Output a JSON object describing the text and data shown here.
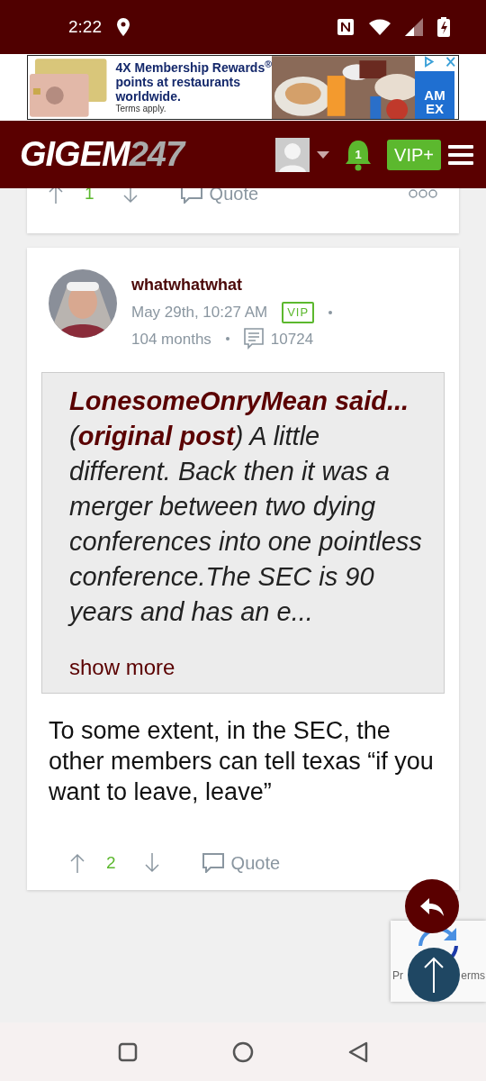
{
  "status_bar": {
    "time": "2:22"
  },
  "ad": {
    "lines": [
      "4X Membership Rewards$^{®}$",
      "points at restaurants",
      "worldwide."
    ],
    "terms": "Terms apply.",
    "logo_lines": [
      "AM",
      "EX"
    ]
  },
  "navbar": {
    "logo": "GIGEM",
    "logo_suffix": "247",
    "notifications": "1",
    "vip_button": "VIP+"
  },
  "posts": [
    {
      "upvotes": "1",
      "quote_button": "Quote",
      "more_menu": true
    },
    {
      "username": "whatwhatwhat",
      "time": "May 29th, 10:27 AM",
      "badge": "VIP",
      "tenure": "104 months",
      "post_count": "10724",
      "quote": {
        "text": "**LonesomeOnryMean said...** (**original post**) A little different. Back then it was a merger between two dying conferences into one pointless conference.The SEC is 90 years and has an e...",
        "show_more": "show more"
      },
      "body": "To some extent, in the SEC, the other members can tell texas “if you want to leave, leave”",
      "upvotes": "2",
      "quote_button": "Quote",
      "more_menu": false
    }
  ],
  "recaptcha": {
    "left_text": "Pr",
    "right_text": "erms"
  }
}
